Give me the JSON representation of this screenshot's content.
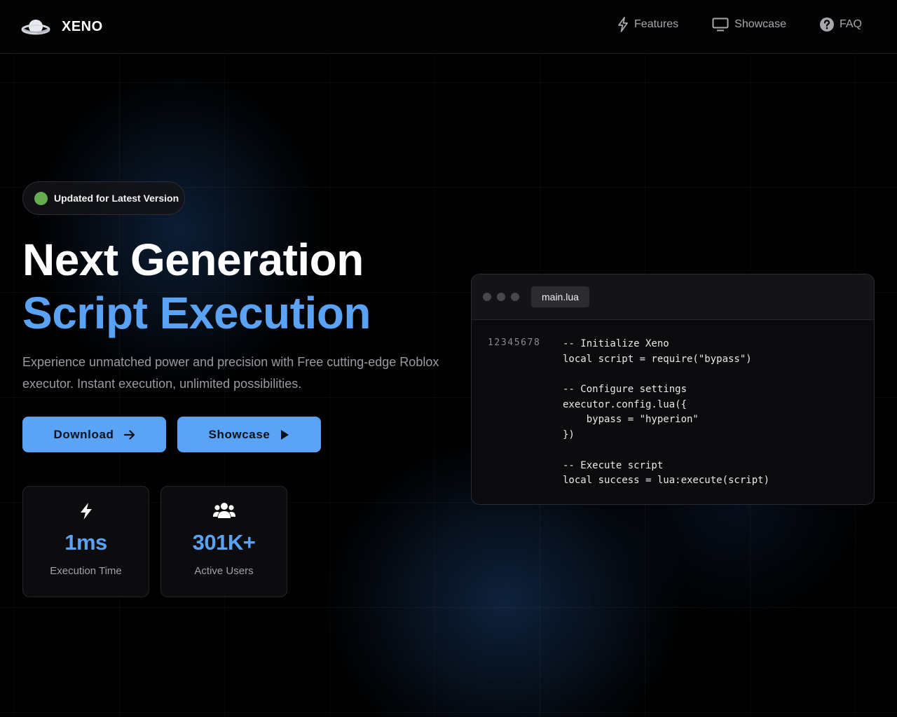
{
  "nav": {
    "brand": "XENO",
    "links": [
      {
        "label": "Features",
        "icon": "bolt-icon"
      },
      {
        "label": "Showcase",
        "icon": "monitor-icon"
      },
      {
        "label": "FAQ",
        "icon": "question-circle-icon"
      }
    ]
  },
  "hero": {
    "badge": "Updated for Latest Version",
    "title_line1": "Next Generation",
    "title_line2": "Script Execution",
    "subtitle": "Experience unmatched power and precision with Free cutting-edge Roblox executor. Instant execution, unlimited possibilities.",
    "download_label": "Download",
    "showcase_label": "Showcase"
  },
  "stats": [
    {
      "value": "1ms",
      "label": "Execution Time",
      "icon": "bolt-icon"
    },
    {
      "value": "301K+",
      "label": "Active Users",
      "icon": "users-icon"
    }
  ],
  "code_window": {
    "filename": "main.lua",
    "line_numbers": "12345678",
    "lines": [
      "-- Initialize Xeno",
      "local script = require(\"bypass\")",
      "",
      "-- Configure settings",
      "executor.config.lua({",
      "    bypass = \"hyperion\"",
      "})",
      "",
      "-- Execute script",
      "local success = lua:execute(script)"
    ]
  },
  "colors": {
    "accent": "#5aa2f4",
    "button": "#5ba3f5",
    "status_dot": "#66ad4f",
    "background": "#000000"
  }
}
